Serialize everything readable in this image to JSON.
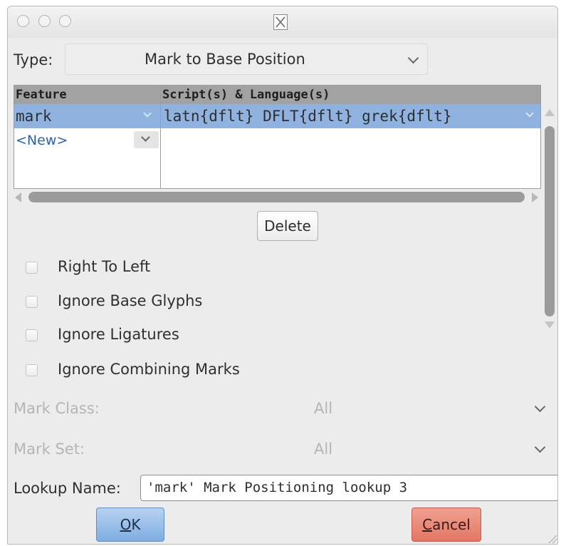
{
  "titlebar": {
    "icon": "x-window-icon"
  },
  "type_field": {
    "label": "Type:",
    "value": "Mark to Base Position"
  },
  "feature_table": {
    "headers": {
      "feature": "Feature",
      "scripts": "Script(s) & Language(s)"
    },
    "rows": [
      {
        "feature": "mark",
        "scripts": "latn{dflt} DFLT{dflt} grek{dflt}"
      },
      {
        "feature": "<New>",
        "scripts": ""
      }
    ]
  },
  "delete_button": "Delete",
  "checkboxes": [
    {
      "label": "Right To Left",
      "checked": false
    },
    {
      "label": "Ignore Base Glyphs",
      "checked": false
    },
    {
      "label": "Ignore Ligatures",
      "checked": false
    },
    {
      "label": "Ignore Combining Marks",
      "checked": false
    }
  ],
  "mark_class": {
    "label": "Mark Class:",
    "value": "All"
  },
  "mark_set": {
    "label": "Mark Set:",
    "value": "All"
  },
  "lookup_name": {
    "label": "Lookup Name:",
    "value": "'mark' Mark Positioning lookup 3"
  },
  "ok_button": {
    "accel": "O",
    "rest": "K"
  },
  "cancel_button": {
    "accel": "C",
    "rest": "ancel"
  }
}
